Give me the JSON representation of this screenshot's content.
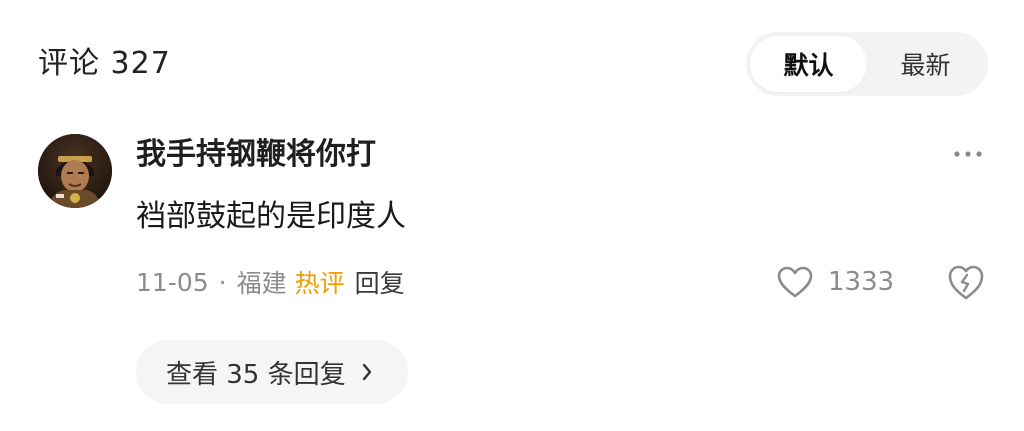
{
  "header": {
    "comments_label": "评论 327",
    "sort_options": [
      {
        "label": "默认",
        "active": true
      },
      {
        "label": "最新",
        "active": false
      }
    ]
  },
  "comment": {
    "username": "我手持钢鞭将你打",
    "text": "裆部鼓起的是印度人",
    "date": "11-05",
    "separator": "·",
    "location": "福建",
    "hot_label": "热评",
    "reply_label": "回复",
    "like_count": "1333",
    "view_replies_label": "查看 35 条回复",
    "icons": {
      "more": "more-horizontal-icon",
      "like": "heart-outline-icon",
      "dislike": "broken-heart-icon",
      "chevron": "chevron-right-icon"
    }
  },
  "colors": {
    "hot_badge": "#f29c00",
    "secondary_text": "#8c8c8c",
    "pill_bg": "#f5f5f7"
  }
}
